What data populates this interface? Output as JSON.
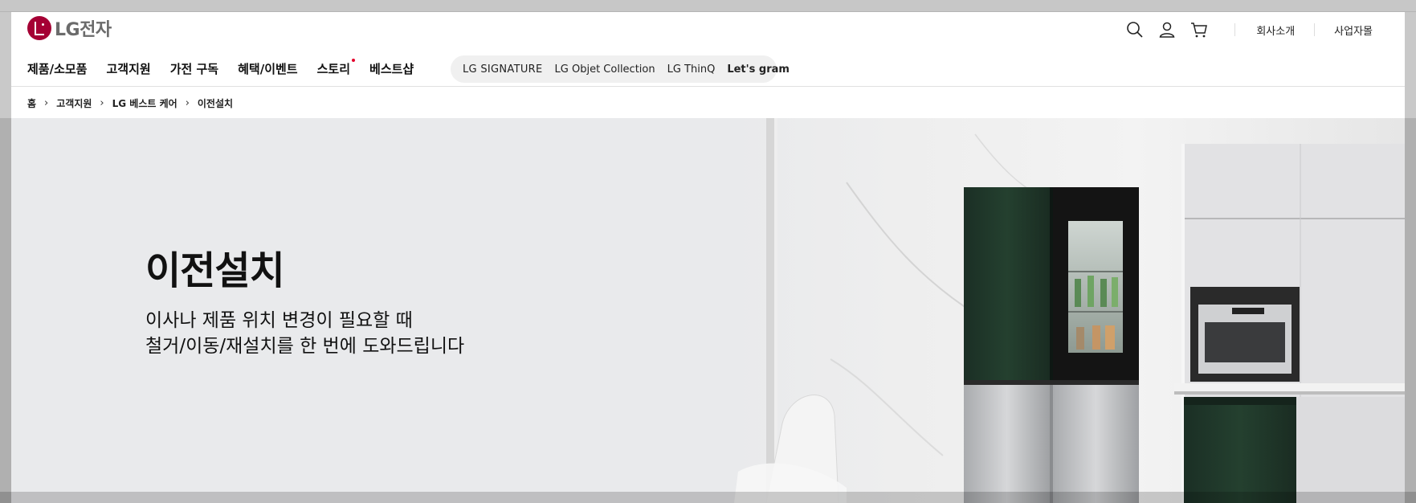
{
  "logo": {
    "text": "LG전자"
  },
  "utility": {
    "icons": [
      "search-icon",
      "user-icon",
      "cart-icon"
    ],
    "links": [
      "회사소개",
      "사업자몰"
    ]
  },
  "gnb": {
    "items": [
      "제품/소모품",
      "고객지원",
      "가전 구독",
      "혜택/이벤트",
      "스토리",
      "베스트샵"
    ]
  },
  "brands": [
    "LG SIGNATURE",
    "LG Objet Collection",
    "LG ThinQ",
    "Let's gram"
  ],
  "breadcrumb": [
    "홈",
    "고객지원",
    "LG 베스트 케어",
    "이전설치"
  ],
  "hero": {
    "title": "이전설치",
    "desc_line1": "이사나 제품 위치 변경이 필요할 때",
    "desc_line2": "철거/이동/재설치를 한 번에 도와드립니다"
  },
  "colors": {
    "brand": "#a50034",
    "notify_dot": "#e4002b",
    "fridge_green": "#1f3a2d"
  }
}
